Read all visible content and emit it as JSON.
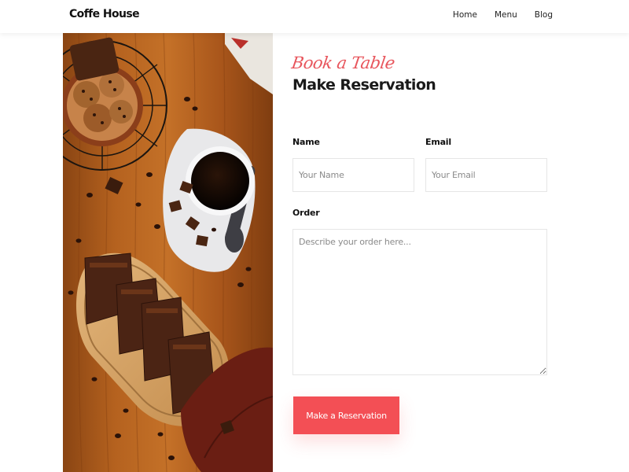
{
  "header": {
    "brand": "Coffe House",
    "nav": [
      {
        "label": "Home"
      },
      {
        "label": "Menu"
      },
      {
        "label": "Blog"
      }
    ]
  },
  "reservation": {
    "eyebrow": "Book a Table",
    "title": "Make Reservation",
    "name_label": "Name",
    "name_placeholder": "Your Name",
    "email_label": "Email",
    "email_placeholder": "Your Email",
    "order_label": "Order",
    "order_placeholder": "Describe your order here...",
    "submit_label": "Make a Reservation"
  },
  "colors": {
    "accent": "#f34f55",
    "eyebrow": "#e8555c",
    "wood": "#b4601f"
  }
}
